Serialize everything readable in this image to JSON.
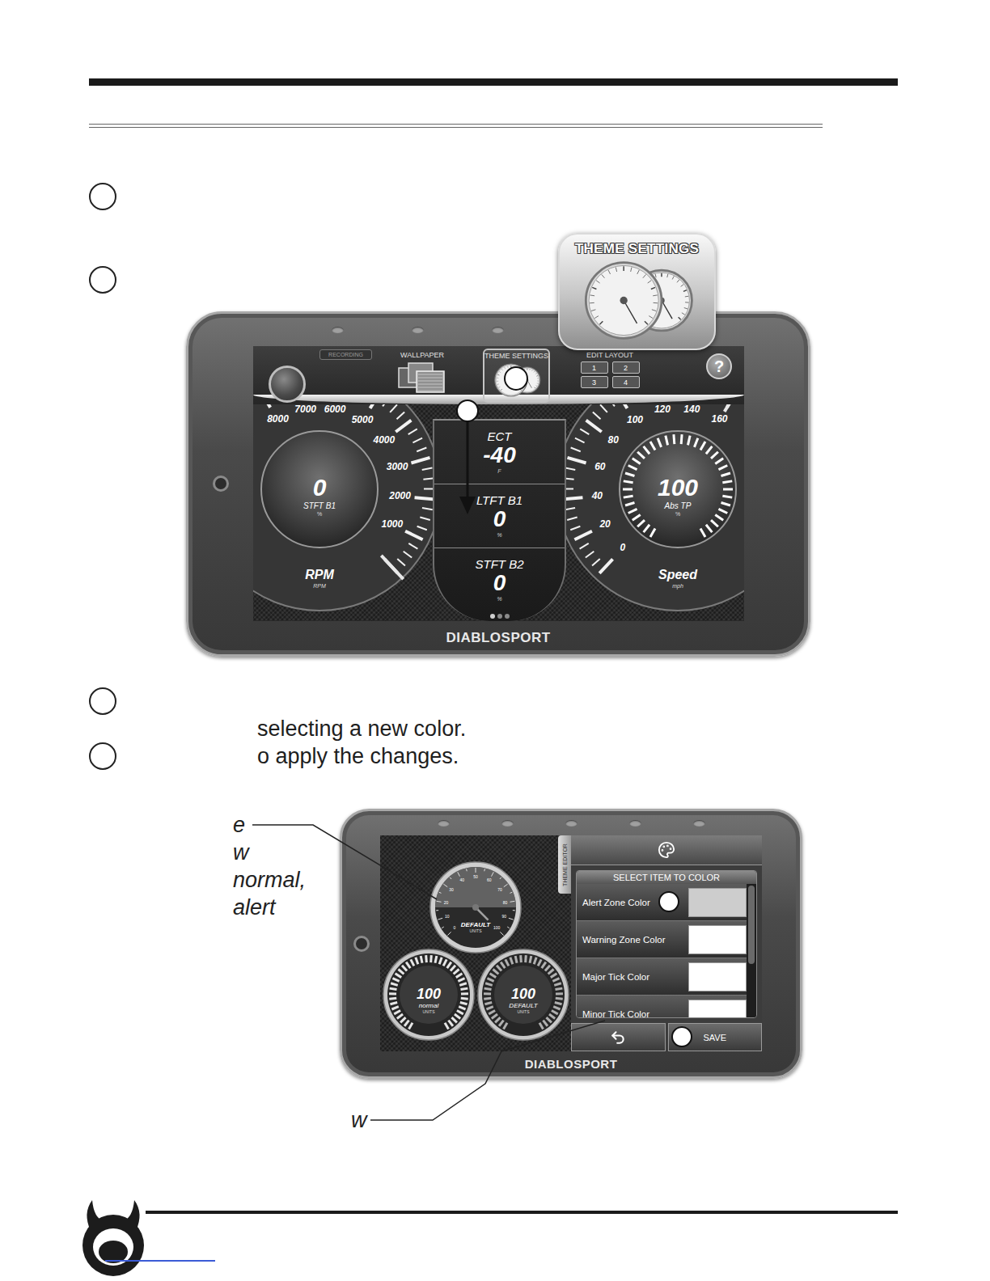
{
  "steps": [
    {
      "lines": [],
      "continued": []
    },
    {
      "lines": [],
      "continued": []
    },
    {
      "lines": [],
      "continued": [
        "selecting a new color."
      ]
    },
    {
      "lines": [
        "o apply the changes."
      ],
      "continued": []
    }
  ],
  "device1": {
    "brand": "DIABLOSPORT",
    "callout": "THEME SETTINGS",
    "toolbar": {
      "recording": "RECORDING",
      "wallpaper": "WALLPAPER",
      "theme_settings": {
        "label": "THEME SETTINGS",
        "selected": true
      },
      "edit_layout": {
        "label": "EDIT LAYOUT",
        "layouts": [
          "1",
          "2",
          "3",
          "4"
        ]
      },
      "help": "?"
    },
    "left_gauge": {
      "ticks": [
        "1000",
        "2000",
        "3000",
        "4000",
        "5000",
        "6000",
        "7000",
        "8000"
      ],
      "level": 0,
      "value": "0",
      "pid": "STFT B1",
      "pid_unit": "%",
      "title": "RPM",
      "title_unit": "RPM"
    },
    "center": [
      {
        "name": "ECT",
        "value": "-40",
        "unit": "F"
      },
      {
        "name": "LTFT B1",
        "value": "0",
        "unit": "%"
      },
      {
        "name": "STFT B2",
        "value": "0",
        "unit": "%"
      }
    ],
    "right_gauge": {
      "ticks": [
        "0",
        "20",
        "40",
        "60",
        "80",
        "100",
        "120",
        "140",
        "160"
      ],
      "level": 1,
      "value": "100",
      "pid": "Abs TP",
      "pid_unit": "%",
      "ring_level": 1,
      "title": "Speed",
      "title_unit": "mph"
    },
    "page_dots": [
      {
        "selected": true
      },
      {
        "selected": false
      },
      {
        "selected": false
      }
    ]
  },
  "device2": {
    "brand": "DIABLOSPORT",
    "side_tab": "THEME EDITOR",
    "list_title": "SELECT ITEM TO COLOR",
    "items": [
      {
        "label": "Alert Zone Color",
        "color": "#cdcdcd"
      },
      {
        "label": "Warning Zone Color",
        "color": "#ffffff"
      },
      {
        "label": "Major Tick Color",
        "color": "#ffffff"
      },
      {
        "label": "Minor Tick Color",
        "color": "#ffffff"
      }
    ],
    "save": "SAVE",
    "gauges": [
      {
        "kind": "dial",
        "ticks": [
          "0",
          "10",
          "20",
          "30",
          "40",
          "50",
          "60",
          "70",
          "80",
          "90",
          "100"
        ],
        "value": "",
        "level": 1,
        "label": "DEFAULT",
        "unit": "UNITS",
        "color": "#7a7a7a"
      },
      {
        "kind": "ring",
        "ticks": [],
        "value": "100",
        "level": 1,
        "label": "normal",
        "unit": "UNITS",
        "color": "#e6e6e6"
      },
      {
        "kind": "ring",
        "ticks": [],
        "value": "100",
        "level": 1,
        "label": "DEFAULT",
        "unit": "UNITS",
        "color": "#b0b0b0"
      }
    ]
  },
  "annotations": {
    "upper": [
      "e",
      "w",
      "normal,",
      "alert"
    ],
    "lower": [
      "w"
    ]
  }
}
